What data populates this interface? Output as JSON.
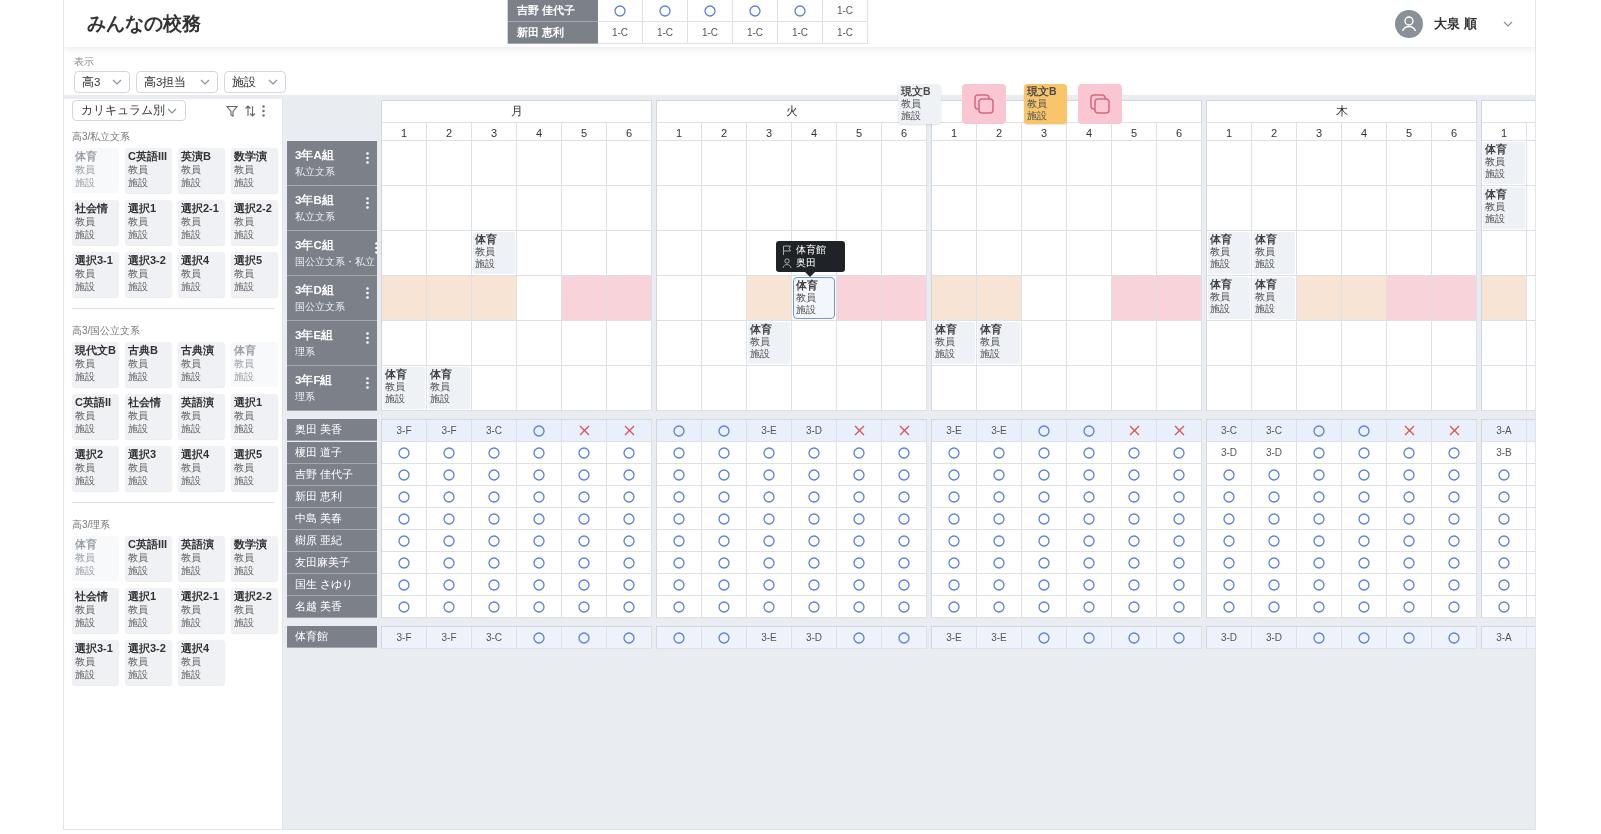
{
  "app": {
    "title": "みんなの校務",
    "user": "大泉 順"
  },
  "preview_rows": [
    {
      "name": "吉野 佳代子",
      "cells": [
        {
          "kind": "free"
        },
        {
          "kind": "free"
        },
        {
          "kind": "free"
        },
        {
          "kind": "free"
        },
        {
          "kind": "free"
        },
        {
          "kind": "class",
          "text": "1-C"
        }
      ]
    },
    {
      "name": "新田 恵利",
      "cells": [
        {
          "kind": "class",
          "text": "1-C"
        },
        {
          "kind": "class",
          "text": "1-C"
        },
        {
          "kind": "class",
          "text": "1-C"
        },
        {
          "kind": "class",
          "text": "1-C"
        },
        {
          "kind": "class",
          "text": "1-C"
        },
        {
          "kind": "class",
          "text": "1-C"
        }
      ]
    }
  ],
  "filters": {
    "label": "表示",
    "dropdowns": [
      "高3",
      "高3担当",
      "施設"
    ]
  },
  "sidebar": {
    "view": "カリキュラム別",
    "groups": [
      {
        "label": "高3/私立文系",
        "cards": [
          {
            "subject": "体育",
            "teacher": "教員",
            "room": "施設",
            "disabled": true
          },
          {
            "subject": "C英語III",
            "teacher": "教員",
            "room": "施設",
            "disabled": false
          },
          {
            "subject": "英演B",
            "teacher": "教員",
            "room": "施設",
            "disabled": false
          },
          {
            "subject": "数学演",
            "teacher": "教員",
            "room": "施設",
            "disabled": false
          },
          {
            "subject": "社会情",
            "teacher": "教員",
            "room": "施設",
            "disabled": false
          },
          {
            "subject": "選択1",
            "teacher": "教員",
            "room": "施設",
            "disabled": false
          },
          {
            "subject": "選択2-1",
            "teacher": "教員",
            "room": "施設",
            "disabled": false
          },
          {
            "subject": "選択2-2",
            "teacher": "教員",
            "room": "施設",
            "disabled": false
          },
          {
            "subject": "選択3-1",
            "teacher": "教員",
            "room": "施設",
            "disabled": false
          },
          {
            "subject": "選択3-2",
            "teacher": "教員",
            "room": "施設",
            "disabled": false
          },
          {
            "subject": "選択4",
            "teacher": "教員",
            "room": "施設",
            "disabled": false
          },
          {
            "subject": "選択5",
            "teacher": "教員",
            "room": "施設",
            "disabled": false
          }
        ]
      },
      {
        "label": "高3/国公立文系",
        "cards": [
          {
            "subject": "現代文B",
            "teacher": "教員",
            "room": "施設",
            "disabled": false
          },
          {
            "subject": "古典B",
            "teacher": "教員",
            "room": "施設",
            "disabled": false
          },
          {
            "subject": "古典演",
            "teacher": "教員",
            "room": "施設",
            "disabled": false
          },
          {
            "subject": "体育",
            "teacher": "教員",
            "room": "施設",
            "disabled": true
          },
          {
            "subject": "C英語II",
            "teacher": "教員",
            "room": "施設",
            "disabled": false
          },
          {
            "subject": "社会情",
            "teacher": "教員",
            "room": "施設",
            "disabled": false
          },
          {
            "subject": "英語演",
            "teacher": "教員",
            "room": "施設",
            "disabled": false
          },
          {
            "subject": "選択1",
            "teacher": "教員",
            "room": "施設",
            "disabled": false
          },
          {
            "subject": "選択2",
            "teacher": "教員",
            "room": "施設",
            "disabled": false
          },
          {
            "subject": "選択3",
            "teacher": "教員",
            "room": "施設",
            "disabled": false
          },
          {
            "subject": "選択4",
            "teacher": "教員",
            "room": "施設",
            "disabled": false
          },
          {
            "subject": "選択5",
            "teacher": "教員",
            "room": "施設",
            "disabled": false
          }
        ]
      },
      {
        "label": "高3/理系",
        "cards": [
          {
            "subject": "体育",
            "teacher": "教員",
            "room": "施設",
            "disabled": true
          },
          {
            "subject": "C英語III",
            "teacher": "教員",
            "room": "施設",
            "disabled": false
          },
          {
            "subject": "英語演",
            "teacher": "教員",
            "room": "施設",
            "disabled": false
          },
          {
            "subject": "数学演",
            "teacher": "教員",
            "room": "施設",
            "disabled": false
          },
          {
            "subject": "社会情",
            "teacher": "教員",
            "room": "施設",
            "disabled": false
          },
          {
            "subject": "選択1",
            "teacher": "教員",
            "room": "施設",
            "disabled": false
          },
          {
            "subject": "選択2-1",
            "teacher": "教員",
            "room": "施設",
            "disabled": false
          },
          {
            "subject": "選択2-2",
            "teacher": "教員",
            "room": "施設",
            "disabled": false
          },
          {
            "subject": "選択3-1",
            "teacher": "教員",
            "room": "施設",
            "disabled": false
          },
          {
            "subject": "選択3-2",
            "teacher": "教員",
            "room": "施設",
            "disabled": false
          },
          {
            "subject": "選択4",
            "teacher": "教員",
            "room": "施設",
            "disabled": false
          }
        ]
      }
    ]
  },
  "timetable": {
    "days": [
      {
        "label": "月",
        "periods": [
          "1",
          "2",
          "3",
          "4",
          "5",
          "6"
        ]
      },
      {
        "label": "火",
        "periods": [
          "1",
          "2",
          "3",
          "4",
          "5",
          "6"
        ]
      },
      {
        "periods": [
          "1",
          "2",
          "3",
          "4",
          "5",
          "6"
        ]
      },
      {
        "label": "木",
        "periods": [
          "1",
          "2",
          "3",
          "4",
          "5",
          "6"
        ]
      },
      {
        "periods": [
          "1"
        ]
      }
    ],
    "classes": [
      {
        "name": "3年A組",
        "track": "私立文系",
        "cells": [
          {
            "kind": "empty"
          },
          {
            "kind": "empty"
          },
          {
            "kind": "empty"
          },
          {
            "kind": "empty"
          },
          {
            "kind": "empty"
          },
          {
            "kind": "empty"
          },
          {
            "kind": "empty"
          },
          {
            "kind": "empty"
          },
          {
            "kind": "empty"
          },
          {
            "kind": "empty"
          },
          {
            "kind": "empty"
          },
          {
            "kind": "empty"
          },
          {
            "kind": "empty"
          },
          {
            "kind": "empty"
          },
          {
            "kind": "empty"
          },
          {
            "kind": "empty"
          },
          {
            "kind": "empty"
          },
          {
            "kind": "empty"
          },
          {
            "kind": "empty"
          },
          {
            "kind": "empty"
          },
          {
            "kind": "empty"
          },
          {
            "kind": "empty"
          },
          {
            "kind": "empty"
          },
          {
            "kind": "empty"
          },
          {
            "kind": "lesson",
            "subject": "体育",
            "teacher": "教員",
            "room": "施設",
            "selected": false
          }
        ]
      },
      {
        "name": "3年B組",
        "track": "私立文系",
        "cells": [
          {
            "kind": "empty"
          },
          {
            "kind": "empty"
          },
          {
            "kind": "empty"
          },
          {
            "kind": "empty"
          },
          {
            "kind": "empty"
          },
          {
            "kind": "empty"
          },
          {
            "kind": "empty"
          },
          {
            "kind": "empty"
          },
          {
            "kind": "empty"
          },
          {
            "kind": "empty"
          },
          {
            "kind": "empty"
          },
          {
            "kind": "empty"
          },
          {
            "kind": "empty"
          },
          {
            "kind": "empty"
          },
          {
            "kind": "empty"
          },
          {
            "kind": "empty"
          },
          {
            "kind": "empty"
          },
          {
            "kind": "empty"
          },
          {
            "kind": "empty"
          },
          {
            "kind": "empty"
          },
          {
            "kind": "empty"
          },
          {
            "kind": "empty"
          },
          {
            "kind": "empty"
          },
          {
            "kind": "empty"
          },
          {
            "kind": "lesson",
            "subject": "体育",
            "teacher": "教員",
            "room": "施設",
            "selected": false
          }
        ]
      },
      {
        "name": "3年C組",
        "track": "国公立文系・私立",
        "cells": [
          {
            "kind": "empty"
          },
          {
            "kind": "empty"
          },
          {
            "kind": "lesson",
            "subject": "体育",
            "teacher": "教員",
            "room": "施設",
            "selected": false
          },
          {
            "kind": "empty"
          },
          {
            "kind": "empty"
          },
          {
            "kind": "empty"
          },
          {
            "kind": "empty"
          },
          {
            "kind": "empty"
          },
          {
            "kind": "empty"
          },
          {
            "kind": "empty"
          },
          {
            "kind": "empty"
          },
          {
            "kind": "empty"
          },
          {
            "kind": "empty"
          },
          {
            "kind": "empty"
          },
          {
            "kind": "empty"
          },
          {
            "kind": "empty"
          },
          {
            "kind": "empty"
          },
          {
            "kind": "empty"
          },
          {
            "kind": "lesson",
            "subject": "体育",
            "teacher": "教員",
            "room": "施設",
            "selected": false
          },
          {
            "kind": "lesson",
            "subject": "体育",
            "teacher": "教員",
            "room": "施設",
            "selected": false
          },
          {
            "kind": "empty"
          },
          {
            "kind": "empty"
          },
          {
            "kind": "empty"
          },
          {
            "kind": "empty"
          },
          {
            "kind": "empty"
          }
        ]
      },
      {
        "name": "3年D組",
        "track": "国公立文系",
        "cells": [
          {
            "kind": "empty",
            "color": "#f7e4d4"
          },
          {
            "kind": "empty",
            "color": "#f7e4d4"
          },
          {
            "kind": "empty",
            "color": "#f7e4d4"
          },
          {
            "kind": "empty"
          },
          {
            "kind": "empty",
            "color": "#f9d3da"
          },
          {
            "kind": "empty",
            "color": "#f9d3da"
          },
          {
            "kind": "empty"
          },
          {
            "kind": "empty"
          },
          {
            "kind": "empty",
            "color": "#f7e4d4"
          },
          {
            "kind": "lesson",
            "subject": "体育",
            "teacher": "教員",
            "room": "施設",
            "selected": true
          },
          {
            "kind": "empty",
            "color": "#f9d3da"
          },
          {
            "kind": "empty",
            "color": "#f9d3da"
          },
          {
            "kind": "empty",
            "color": "#f7e4d4"
          },
          {
            "kind": "empty",
            "color": "#f7e4d4"
          },
          {
            "kind": "empty"
          },
          {
            "kind": "empty"
          },
          {
            "kind": "empty",
            "color": "#f9d3da"
          },
          {
            "kind": "empty",
            "color": "#f9d3da"
          },
          {
            "kind": "lesson",
            "subject": "体育",
            "teacher": "教員",
            "room": "施設",
            "selected": false
          },
          {
            "kind": "lesson",
            "subject": "体育",
            "teacher": "教員",
            "room": "施設",
            "selected": false
          },
          {
            "kind": "empty",
            "color": "#f7e4d4"
          },
          {
            "kind": "empty",
            "color": "#f7e4d4"
          },
          {
            "kind": "empty",
            "color": "#f9d3da"
          },
          {
            "kind": "empty",
            "color": "#f9d3da"
          },
          {
            "kind": "empty",
            "color": "#f7e4d4"
          }
        ]
      },
      {
        "name": "3年E組",
        "track": "理系",
        "cells": [
          {
            "kind": "empty"
          },
          {
            "kind": "empty"
          },
          {
            "kind": "empty"
          },
          {
            "kind": "empty"
          },
          {
            "kind": "empty"
          },
          {
            "kind": "empty"
          },
          {
            "kind": "empty"
          },
          {
            "kind": "empty"
          },
          {
            "kind": "lesson",
            "subject": "体育",
            "teacher": "教員",
            "room": "施設",
            "selected": false
          },
          {
            "kind": "empty"
          },
          {
            "kind": "empty"
          },
          {
            "kind": "empty"
          },
          {
            "kind": "lesson",
            "subject": "体育",
            "teacher": "教員",
            "room": "施設",
            "selected": false
          },
          {
            "kind": "lesson",
            "subject": "体育",
            "teacher": "教員",
            "room": "施設",
            "selected": false
          },
          {
            "kind": "empty"
          },
          {
            "kind": "empty"
          },
          {
            "kind": "empty"
          },
          {
            "kind": "empty"
          },
          {
            "kind": "empty"
          },
          {
            "kind": "empty"
          },
          {
            "kind": "empty"
          },
          {
            "kind": "empty"
          },
          {
            "kind": "empty"
          },
          {
            "kind": "empty"
          },
          {
            "kind": "empty"
          }
        ]
      },
      {
        "name": "3年F組",
        "track": "理系",
        "cells": [
          {
            "kind": "lesson",
            "subject": "体育",
            "teacher": "教員",
            "room": "施設",
            "selected": false
          },
          {
            "kind": "lesson",
            "subject": "体育",
            "teacher": "教員",
            "room": "施設",
            "selected": false
          },
          {
            "kind": "empty"
          },
          {
            "kind": "empty"
          },
          {
            "kind": "empty"
          },
          {
            "kind": "empty"
          },
          {
            "kind": "empty"
          },
          {
            "kind": "empty"
          },
          {
            "kind": "empty"
          },
          {
            "kind": "empty"
          },
          {
            "kind": "empty"
          },
          {
            "kind": "empty"
          },
          {
            "kind": "empty"
          },
          {
            "kind": "empty"
          },
          {
            "kind": "empty"
          },
          {
            "kind": "empty"
          },
          {
            "kind": "empty"
          },
          {
            "kind": "empty"
          },
          {
            "kind": "empty"
          },
          {
            "kind": "empty"
          },
          {
            "kind": "empty"
          },
          {
            "kind": "empty"
          },
          {
            "kind": "empty"
          },
          {
            "kind": "empty"
          },
          {
            "kind": "empty"
          }
        ]
      }
    ],
    "teachers": [
      {
        "name": "奥田 美香",
        "selected": true,
        "cells": [
          {
            "kind": "class",
            "text": "3-F"
          },
          {
            "kind": "class",
            "text": "3-F"
          },
          {
            "kind": "class",
            "text": "3-C"
          },
          {
            "kind": "free"
          },
          {
            "kind": "busy"
          },
          {
            "kind": "busy"
          },
          {
            "kind": "free"
          },
          {
            "kind": "free"
          },
          {
            "kind": "class",
            "text": "3-E"
          },
          {
            "kind": "class",
            "text": "3-D"
          },
          {
            "kind": "busy"
          },
          {
            "kind": "busy"
          },
          {
            "kind": "class",
            "text": "3-E"
          },
          {
            "kind": "class",
            "text": "3-E"
          },
          {
            "kind": "free"
          },
          {
            "kind": "free"
          },
          {
            "kind": "busy"
          },
          {
            "kind": "busy"
          },
          {
            "kind": "class",
            "text": "3-C"
          },
          {
            "kind": "class",
            "text": "3-C"
          },
          {
            "kind": "free"
          },
          {
            "kind": "free"
          },
          {
            "kind": "busy"
          },
          {
            "kind": "busy"
          },
          {
            "kind": "class",
            "text": "3-A"
          }
        ]
      },
      {
        "name": "榎田 道子",
        "selected": false,
        "cells": [
          {
            "kind": "free"
          },
          {
            "kind": "free"
          },
          {
            "kind": "free"
          },
          {
            "kind": "free"
          },
          {
            "kind": "free"
          },
          {
            "kind": "free"
          },
          {
            "kind": "free"
          },
          {
            "kind": "free"
          },
          {
            "kind": "free"
          },
          {
            "kind": "free"
          },
          {
            "kind": "free"
          },
          {
            "kind": "free"
          },
          {
            "kind": "free"
          },
          {
            "kind": "free"
          },
          {
            "kind": "free"
          },
          {
            "kind": "free"
          },
          {
            "kind": "free"
          },
          {
            "kind": "free"
          },
          {
            "kind": "class",
            "text": "3-D"
          },
          {
            "kind": "class",
            "text": "3-D"
          },
          {
            "kind": "free"
          },
          {
            "kind": "free"
          },
          {
            "kind": "free"
          },
          {
            "kind": "free"
          },
          {
            "kind": "class",
            "text": "3-B"
          }
        ]
      },
      {
        "name": "吉野 佳代子",
        "selected": false,
        "cells": [
          {
            "kind": "free"
          },
          {
            "kind": "free"
          },
          {
            "kind": "free"
          },
          {
            "kind": "free"
          },
          {
            "kind": "free"
          },
          {
            "kind": "free"
          },
          {
            "kind": "free"
          },
          {
            "kind": "free"
          },
          {
            "kind": "free"
          },
          {
            "kind": "free"
          },
          {
            "kind": "free"
          },
          {
            "kind": "free"
          },
          {
            "kind": "free"
          },
          {
            "kind": "free"
          },
          {
            "kind": "free"
          },
          {
            "kind": "free"
          },
          {
            "kind": "free"
          },
          {
            "kind": "free"
          },
          {
            "kind": "free"
          },
          {
            "kind": "free"
          },
          {
            "kind": "free"
          },
          {
            "kind": "free"
          },
          {
            "kind": "free"
          },
          {
            "kind": "free"
          },
          {
            "kind": "free"
          }
        ]
      },
      {
        "name": "新田 恵利",
        "selected": false,
        "cells": [
          {
            "kind": "free"
          },
          {
            "kind": "free"
          },
          {
            "kind": "free"
          },
          {
            "kind": "free"
          },
          {
            "kind": "free"
          },
          {
            "kind": "free"
          },
          {
            "kind": "free"
          },
          {
            "kind": "free"
          },
          {
            "kind": "free"
          },
          {
            "kind": "free"
          },
          {
            "kind": "free"
          },
          {
            "kind": "free"
          },
          {
            "kind": "free"
          },
          {
            "kind": "free"
          },
          {
            "kind": "free"
          },
          {
            "kind": "free"
          },
          {
            "kind": "free"
          },
          {
            "kind": "free"
          },
          {
            "kind": "free"
          },
          {
            "kind": "free"
          },
          {
            "kind": "free"
          },
          {
            "kind": "free"
          },
          {
            "kind": "free"
          },
          {
            "kind": "free"
          },
          {
            "kind": "free"
          }
        ]
      },
      {
        "name": "中島 美春",
        "selected": false,
        "cells": [
          {
            "kind": "free"
          },
          {
            "kind": "free"
          },
          {
            "kind": "free"
          },
          {
            "kind": "free"
          },
          {
            "kind": "free"
          },
          {
            "kind": "free"
          },
          {
            "kind": "free"
          },
          {
            "kind": "free"
          },
          {
            "kind": "free"
          },
          {
            "kind": "free"
          },
          {
            "kind": "free"
          },
          {
            "kind": "free"
          },
          {
            "kind": "free"
          },
          {
            "kind": "free"
          },
          {
            "kind": "free"
          },
          {
            "kind": "free"
          },
          {
            "kind": "free"
          },
          {
            "kind": "free"
          },
          {
            "kind": "free"
          },
          {
            "kind": "free"
          },
          {
            "kind": "free"
          },
          {
            "kind": "free"
          },
          {
            "kind": "free"
          },
          {
            "kind": "free"
          },
          {
            "kind": "free"
          }
        ]
      },
      {
        "name": "樹原 亜紀",
        "selected": false,
        "cells": [
          {
            "kind": "free"
          },
          {
            "kind": "free"
          },
          {
            "kind": "free"
          },
          {
            "kind": "free"
          },
          {
            "kind": "free"
          },
          {
            "kind": "free"
          },
          {
            "kind": "free"
          },
          {
            "kind": "free"
          },
          {
            "kind": "free"
          },
          {
            "kind": "free"
          },
          {
            "kind": "free"
          },
          {
            "kind": "free"
          },
          {
            "kind": "free"
          },
          {
            "kind": "free"
          },
          {
            "kind": "free"
          },
          {
            "kind": "free"
          },
          {
            "kind": "free"
          },
          {
            "kind": "free"
          },
          {
            "kind": "free"
          },
          {
            "kind": "free"
          },
          {
            "kind": "free"
          },
          {
            "kind": "free"
          },
          {
            "kind": "free"
          },
          {
            "kind": "free"
          },
          {
            "kind": "free"
          }
        ]
      },
      {
        "name": "友田麻美子",
        "selected": false,
        "cells": [
          {
            "kind": "free"
          },
          {
            "kind": "free"
          },
          {
            "kind": "free"
          },
          {
            "kind": "free"
          },
          {
            "kind": "free"
          },
          {
            "kind": "free"
          },
          {
            "kind": "free"
          },
          {
            "kind": "free"
          },
          {
            "kind": "free"
          },
          {
            "kind": "free"
          },
          {
            "kind": "free"
          },
          {
            "kind": "free"
          },
          {
            "kind": "free"
          },
          {
            "kind": "free"
          },
          {
            "kind": "free"
          },
          {
            "kind": "free"
          },
          {
            "kind": "free"
          },
          {
            "kind": "free"
          },
          {
            "kind": "free"
          },
          {
            "kind": "free"
          },
          {
            "kind": "free"
          },
          {
            "kind": "free"
          },
          {
            "kind": "free"
          },
          {
            "kind": "free"
          },
          {
            "kind": "free"
          }
        ]
      },
      {
        "name": "国生 さゆり",
        "selected": false,
        "cells": [
          {
            "kind": "free"
          },
          {
            "kind": "free"
          },
          {
            "kind": "free"
          },
          {
            "kind": "free"
          },
          {
            "kind": "free"
          },
          {
            "kind": "free"
          },
          {
            "kind": "free"
          },
          {
            "kind": "free"
          },
          {
            "kind": "free"
          },
          {
            "kind": "free"
          },
          {
            "kind": "free"
          },
          {
            "kind": "free"
          },
          {
            "kind": "free"
          },
          {
            "kind": "free"
          },
          {
            "kind": "free"
          },
          {
            "kind": "free"
          },
          {
            "kind": "free"
          },
          {
            "kind": "free"
          },
          {
            "kind": "free"
          },
          {
            "kind": "free"
          },
          {
            "kind": "free"
          },
          {
            "kind": "free"
          },
          {
            "kind": "free"
          },
          {
            "kind": "free"
          },
          {
            "kind": "free"
          }
        ]
      },
      {
        "name": "名越 美香",
        "selected": false,
        "cells": [
          {
            "kind": "free"
          },
          {
            "kind": "free"
          },
          {
            "kind": "free"
          },
          {
            "kind": "free"
          },
          {
            "kind": "free"
          },
          {
            "kind": "free"
          },
          {
            "kind": "free"
          },
          {
            "kind": "free"
          },
          {
            "kind": "free"
          },
          {
            "kind": "free"
          },
          {
            "kind": "free"
          },
          {
            "kind": "free"
          },
          {
            "kind": "free"
          },
          {
            "kind": "free"
          },
          {
            "kind": "free"
          },
          {
            "kind": "free"
          },
          {
            "kind": "free"
          },
          {
            "kind": "free"
          },
          {
            "kind": "free"
          },
          {
            "kind": "free"
          },
          {
            "kind": "free"
          },
          {
            "kind": "free"
          },
          {
            "kind": "free"
          },
          {
            "kind": "free"
          },
          {
            "kind": "free"
          }
        ]
      }
    ],
    "facilities": [
      {
        "name": "体育館",
        "cells": [
          {
            "kind": "class",
            "text": "3-F"
          },
          {
            "kind": "class",
            "text": "3-F"
          },
          {
            "kind": "class",
            "text": "3-C"
          },
          {
            "kind": "free"
          },
          {
            "kind": "free"
          },
          {
            "kind": "free"
          },
          {
            "kind": "free"
          },
          {
            "kind": "free"
          },
          {
            "kind": "class",
            "text": "3-E"
          },
          {
            "kind": "class",
            "text": "3-D"
          },
          {
            "kind": "free"
          },
          {
            "kind": "free"
          },
          {
            "kind": "class",
            "text": "3-E"
          },
          {
            "kind": "class",
            "text": "3-E"
          },
          {
            "kind": "free"
          },
          {
            "kind": "free"
          },
          {
            "kind": "free"
          },
          {
            "kind": "free"
          },
          {
            "kind": "class",
            "text": "3-D"
          },
          {
            "kind": "class",
            "text": "3-D"
          },
          {
            "kind": "free"
          },
          {
            "kind": "free"
          },
          {
            "kind": "free"
          },
          {
            "kind": "free"
          },
          {
            "kind": "class",
            "text": "3-A"
          }
        ]
      }
    ]
  },
  "tooltip": {
    "facility": "体育館",
    "teacher": "奥田"
  },
  "floating": [
    {
      "kind": "lesson",
      "subject": "現文B",
      "teacher": "教員",
      "room": "施設",
      "color": "#eef1f6"
    },
    {
      "kind": "copy"
    },
    {
      "kind": "lesson",
      "subject": "現文B",
      "teacher": "教員",
      "room": "施設",
      "color": "#f8c56b"
    },
    {
      "kind": "copy"
    }
  ]
}
